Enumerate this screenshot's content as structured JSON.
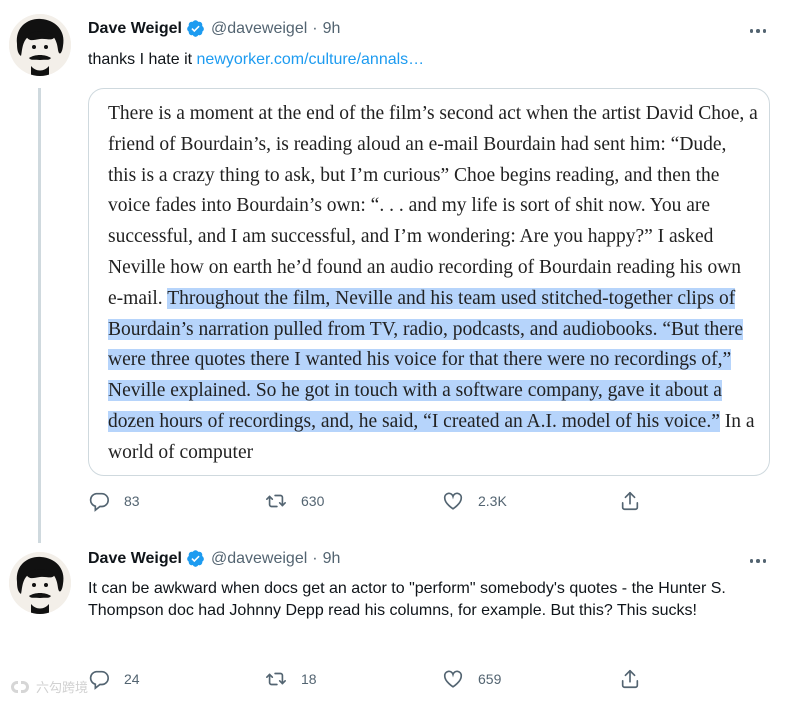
{
  "tweets": [
    {
      "author": {
        "name": "Dave Weigel",
        "handle": "@daveweigel",
        "time": "9h"
      },
      "text": "thanks I hate it",
      "link": "newyorker.com/culture/annals…",
      "quote_card": {
        "text_plain": "There is a moment at the end of the film’s second act when the artist David Choe, a friend of Bourdain’s, is reading aloud an e-mail Bourdain had sent him: “Dude, this is a crazy thing to ask, but I’m curious” Choe begins reading, and then the voice fades into Bourdain’s own: “. . . and my life is sort of shit now. You are successful, and I am successful, and I’m wondering: Are you happy?” I asked Neville how on earth he’d found an audio recording of Bourdain reading his own e-mail.",
        "text_highlighted": "Throughout the film, Neville and his team used stitched-together clips of Bourdain’s narration pulled from TV, radio, podcasts, and audiobooks. “But there were three quotes there I wanted his voice for that there were no recordings of,” Neville explained. So he got in touch with a software company, gave it about a dozen hours of recordings, and, he said, “I created an A.I. model of his voice.”",
        "text_tail": "In a world of computer"
      },
      "actions": {
        "replies": "83",
        "retweets": "630",
        "likes": "2.3K"
      }
    },
    {
      "author": {
        "name": "Dave Weigel",
        "handle": "@daveweigel",
        "time": "9h"
      },
      "text": "It can be awkward when docs get an actor to \"perform\" somebody's quotes - the Hunter S. Thompson doc had Johnny Depp read his columns, for example. But this? This sucks!",
      "actions": {
        "replies": "24",
        "retweets": "18",
        "likes": "659"
      }
    }
  ],
  "separator": "·",
  "icons": {
    "verified": "verified-badge-icon",
    "more": "more-options-icon",
    "reply": "reply-icon",
    "retweet": "retweet-icon",
    "like": "heart-icon",
    "share": "share-icon"
  },
  "colors": {
    "accent": "#1d9bf0",
    "muted": "#536471",
    "highlight": "#b6d4fb",
    "border": "#cfd9de"
  },
  "watermark": "六勾跨境"
}
